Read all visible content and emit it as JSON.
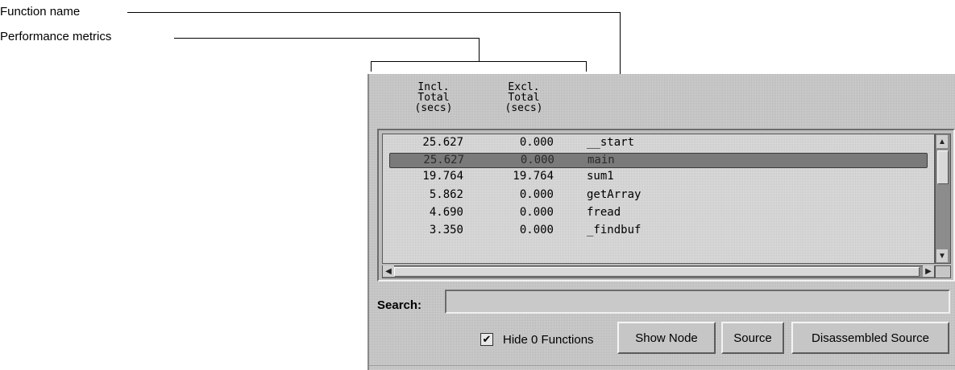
{
  "annotations": {
    "function_name": "Function name",
    "performance_metrics": "Performance metrics"
  },
  "columns": {
    "incl": [
      "Incl.",
      "Total",
      "(secs)"
    ],
    "excl": [
      "Excl.",
      "Total",
      "(secs)"
    ]
  },
  "rows": [
    {
      "incl": "25.627",
      "excl": "0.000",
      "name": "__start"
    },
    {
      "incl": "25.627",
      "excl": "0.000",
      "name": "main",
      "selected": true
    },
    {
      "incl": "19.764",
      "excl": "19.764",
      "name": "sum1"
    },
    {
      "incl": "5.862",
      "excl": "0.000",
      "name": "getArray"
    },
    {
      "incl": "4.690",
      "excl": "0.000",
      "name": "fread"
    },
    {
      "incl": "3.350",
      "excl": "0.000",
      "name": "_findbuf"
    }
  ],
  "search": {
    "label": "Search:",
    "value": ""
  },
  "hide_zero": {
    "label": "Hide 0 Functions",
    "checked": true
  },
  "buttons": {
    "show_node": "Show Node",
    "source": "Source",
    "disassembled": "Disassembled Source"
  }
}
